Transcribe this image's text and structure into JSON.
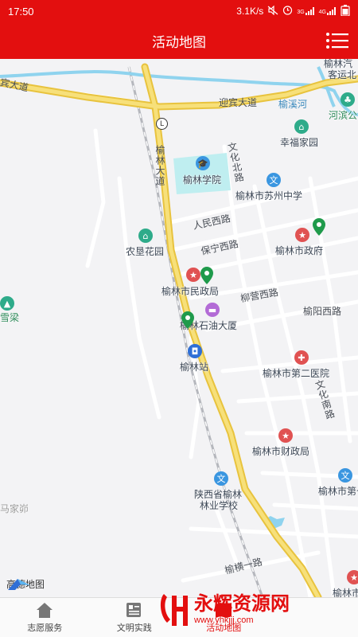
{
  "status_bar": {
    "time": "17:50",
    "net_speed": "3.1K/s",
    "signal1": "3G",
    "signal2": "4G"
  },
  "header": {
    "title": "活动地图"
  },
  "map": {
    "labels": {
      "yulin_xueyuan": "榆林学院",
      "xingfu_jiayuan": "幸福家园",
      "suzhou_zhongxue": "榆林市苏州中学",
      "nongken_huayuan": "农垦花园",
      "shi_zhengfu": "榆林市政府",
      "minzheng_ju": "榆林市民政局",
      "shiyou_dasha": "榆林石油大厦",
      "yulin_zhan": "榆林站",
      "dier_yiyuan": "榆林市第二医院",
      "caizheng_ju": "榆林市财政局",
      "linye_xuexiao_1": "陕西省榆林",
      "linye_xuexiao_2": "林业学校",
      "yulin_shidi": "榆林市第七",
      "yulin_edge": "榆林市",
      "kezhan_1": "榆林汽",
      "kezhan_2": "客运北",
      "hebin": "河滨公",
      "xueliang": "雪梁",
      "jiacha": "马家峁"
    },
    "roads": {
      "yingbin": "迎宾大道",
      "yuxi_he": "榆溪河",
      "yulin_dadao": "榆林大道",
      "wenhua_bei": "文化北路",
      "renmin_xi": "人民西路",
      "baoning_xi": "保宁西路",
      "liuying_xi": "柳营西路",
      "yuyang_xi": "榆阳西路",
      "wenhua_nan": "文化南路",
      "yuheng_yi": "榆横一路",
      "top_left": "宾大道"
    },
    "logo_text": "高德地图"
  },
  "tabs": [
    {
      "label": "志愿服务",
      "icon": "home-icon"
    },
    {
      "label": "文明实践",
      "icon": "news-icon"
    },
    {
      "label": "活动地图",
      "icon": "map-icon",
      "active": true
    }
  ],
  "watermark": {
    "text": "永辉资源网",
    "url": "www.yhkjjj.com"
  },
  "colors": {
    "brand_red": "#e30f0f",
    "main_road": "#f4d64e",
    "river": "#8fd3ee"
  }
}
